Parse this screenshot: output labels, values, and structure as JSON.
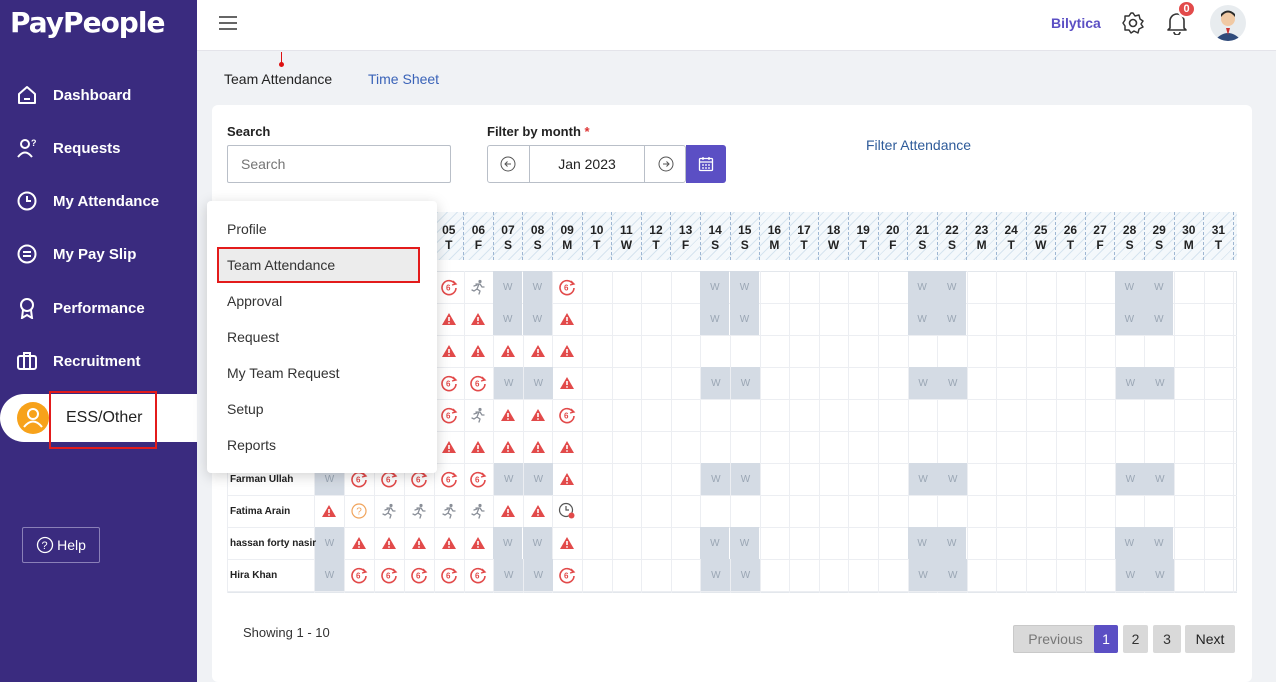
{
  "app": {
    "logo": "PayPeople",
    "company": "Bilytica",
    "notifications": "0"
  },
  "sidebar": {
    "items": [
      {
        "label": "Dashboard",
        "icon": "home-icon"
      },
      {
        "label": "Requests",
        "icon": "user-question-icon"
      },
      {
        "label": "My Attendance",
        "icon": "clock-icon"
      },
      {
        "label": "My Pay Slip",
        "icon": "receipt-icon"
      },
      {
        "label": "Performance",
        "icon": "award-icon"
      },
      {
        "label": "Recruitment",
        "icon": "briefcase-icon"
      }
    ],
    "active": {
      "label": "ESS/Other",
      "icon": "user-icon"
    },
    "help": "Help"
  },
  "tabs": {
    "team_attendance": "Team Attendance",
    "time_sheet": "Time Sheet"
  },
  "filters": {
    "search_label": "Search",
    "search_placeholder": "Search",
    "month_label": "Filter by month",
    "required_mark": "*",
    "month_value": "Jan 2023",
    "filter_link": "Filter Attendance"
  },
  "calendar": {
    "days": [
      {
        "d": "05",
        "w": "T"
      },
      {
        "d": "06",
        "w": "F"
      },
      {
        "d": "07",
        "w": "S"
      },
      {
        "d": "08",
        "w": "S"
      },
      {
        "d": "09",
        "w": "M"
      },
      {
        "d": "10",
        "w": "T"
      },
      {
        "d": "11",
        "w": "W"
      },
      {
        "d": "12",
        "w": "T"
      },
      {
        "d": "13",
        "w": "F"
      },
      {
        "d": "14",
        "w": "S"
      },
      {
        "d": "15",
        "w": "S"
      },
      {
        "d": "16",
        "w": "M"
      },
      {
        "d": "17",
        "w": "T"
      },
      {
        "d": "18",
        "w": "W"
      },
      {
        "d": "19",
        "w": "T"
      },
      {
        "d": "20",
        "w": "F"
      },
      {
        "d": "21",
        "w": "S"
      },
      {
        "d": "22",
        "w": "S"
      },
      {
        "d": "23",
        "w": "M"
      },
      {
        "d": "24",
        "w": "T"
      },
      {
        "d": "25",
        "w": "W"
      },
      {
        "d": "26",
        "w": "T"
      },
      {
        "d": "27",
        "w": "F"
      },
      {
        "d": "28",
        "w": "S"
      },
      {
        "d": "29",
        "w": "S"
      },
      {
        "d": "30",
        "w": "M"
      },
      {
        "d": "31",
        "w": "T"
      }
    ],
    "weekend_mark": "W",
    "unknown_mark": "?",
    "leave_mark": "6",
    "employees": [
      "Farman Ullah",
      "Fatima Arain",
      "hassan forty nasir",
      "Hira Khan"
    ]
  },
  "menu": {
    "items": [
      "Profile",
      "Team Attendance",
      "Approval",
      "Request",
      "My Team Request",
      "Setup",
      "Reports"
    ]
  },
  "pagination": {
    "showing": "Showing 1 - 10",
    "previous": "Previous",
    "pages": [
      "1",
      "2",
      "3"
    ],
    "next": "Next"
  },
  "colors": {
    "sidebar": "#3a2b7f",
    "accent": "#5b4fc4",
    "alert": "#e24a4a",
    "weekend": "#d4dbe4",
    "highlight_border": "#e31b1b"
  }
}
